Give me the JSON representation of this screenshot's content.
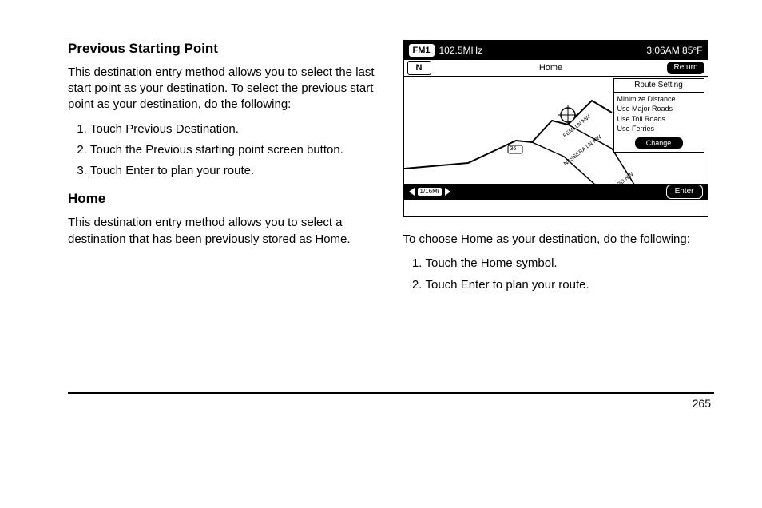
{
  "left": {
    "h1": "Previous Starting Point",
    "p1": "This destination entry method allows you to select the last start point as your destination. To select the previous start point as your destination, do the following:",
    "steps": [
      "Touch Previous Destination.",
      "Touch the Previous starting point screen button.",
      "Touch Enter to plan your route."
    ],
    "h2": "Home",
    "p2": "This destination entry method allows you to select a destination that has been previously stored as Home."
  },
  "right": {
    "p1": "To choose Home as your destination, do the following:",
    "steps": [
      "Touch the Home symbol.",
      "Touch Enter to plan your route."
    ]
  },
  "device": {
    "band": "FM1",
    "freq": "102.5MHz",
    "clock": "3:06AM 85°F",
    "compass": "N",
    "title": "Home",
    "return": "Return",
    "route_hdr": "Route Setting",
    "route_opts": [
      "Minimize Distance",
      "Use Major Roads",
      "Use Toll Roads",
      "Use Ferries"
    ],
    "change": "Change",
    "scale": "1/16Mi",
    "enter": "Enter",
    "roads": {
      "a": "FEMI LN NW",
      "b": "NASSERA LN NW",
      "c": "ER RD NW",
      "hw": "36"
    }
  },
  "page_no": "265"
}
